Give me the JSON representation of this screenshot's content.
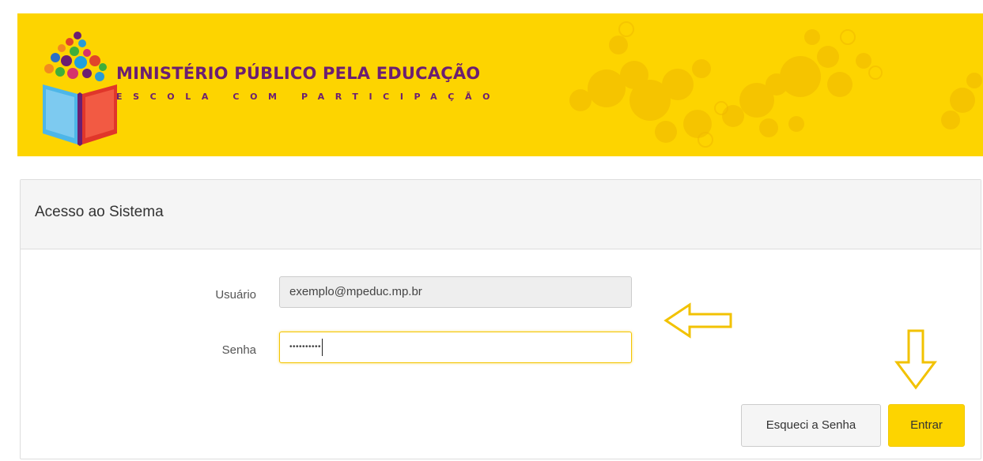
{
  "banner": {
    "title": "MINISTÉRIO PÚBLICO PELA EDUCAÇÃO",
    "subtitle": "ESCOLA COM PARTICIPAÇÃO",
    "background_color": "#fdd400",
    "brand_color": "#6b1e72"
  },
  "panel": {
    "title": "Acesso ao Sistema"
  },
  "form": {
    "user_label": "Usuário",
    "user_value": "exemplo@mpeduc.mp.br",
    "password_label": "Senha",
    "password_value": "••••••••••"
  },
  "buttons": {
    "forgot_label": "Esqueci a Senha",
    "enter_label": "Entrar"
  },
  "annotations": {
    "left_arrow_icon": "arrow-left-icon",
    "down_arrow_icon": "arrow-down-icon",
    "color": "#f2c200"
  }
}
